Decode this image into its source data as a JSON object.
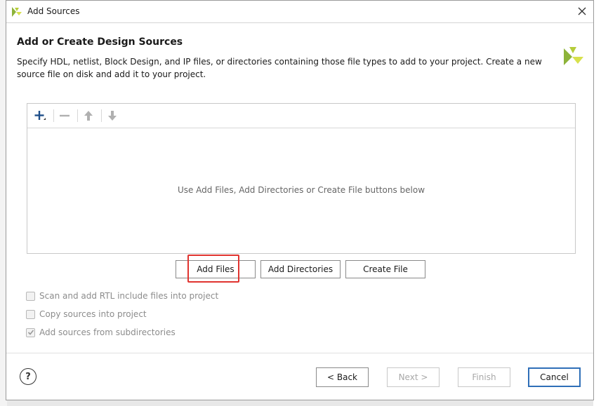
{
  "window": {
    "title": "Add Sources",
    "close_icon": "close-icon"
  },
  "page": {
    "heading": "Add or Create Design Sources",
    "description": "Specify HDL, netlist, Block Design, and IP files, or directories containing those file types to add to your project. Create a new source file on disk and add it to your project."
  },
  "file_list": {
    "toolbar": {
      "add": "plus-icon",
      "remove": "minus-icon",
      "move_up": "arrow-up-icon",
      "move_down": "arrow-down-icon"
    },
    "empty_hint": "Use Add Files, Add Directories or Create File buttons below"
  },
  "actions": {
    "add_files": "Add Files",
    "add_directories": "Add Directories",
    "create_file": "Create File"
  },
  "options": [
    {
      "label": "Scan and add RTL include files into project",
      "checked": false
    },
    {
      "label": "Copy sources into project",
      "checked": false
    },
    {
      "label": "Add sources from subdirectories",
      "checked": true
    }
  ],
  "footer": {
    "help": "?",
    "back": "< Back",
    "next": "Next >",
    "finish": "Finish",
    "cancel": "Cancel"
  },
  "colors": {
    "highlight": "#e0332f",
    "primary_border": "#2f6fb8",
    "logo_green": "#8db33a",
    "logo_yellow": "#d7e14d"
  }
}
